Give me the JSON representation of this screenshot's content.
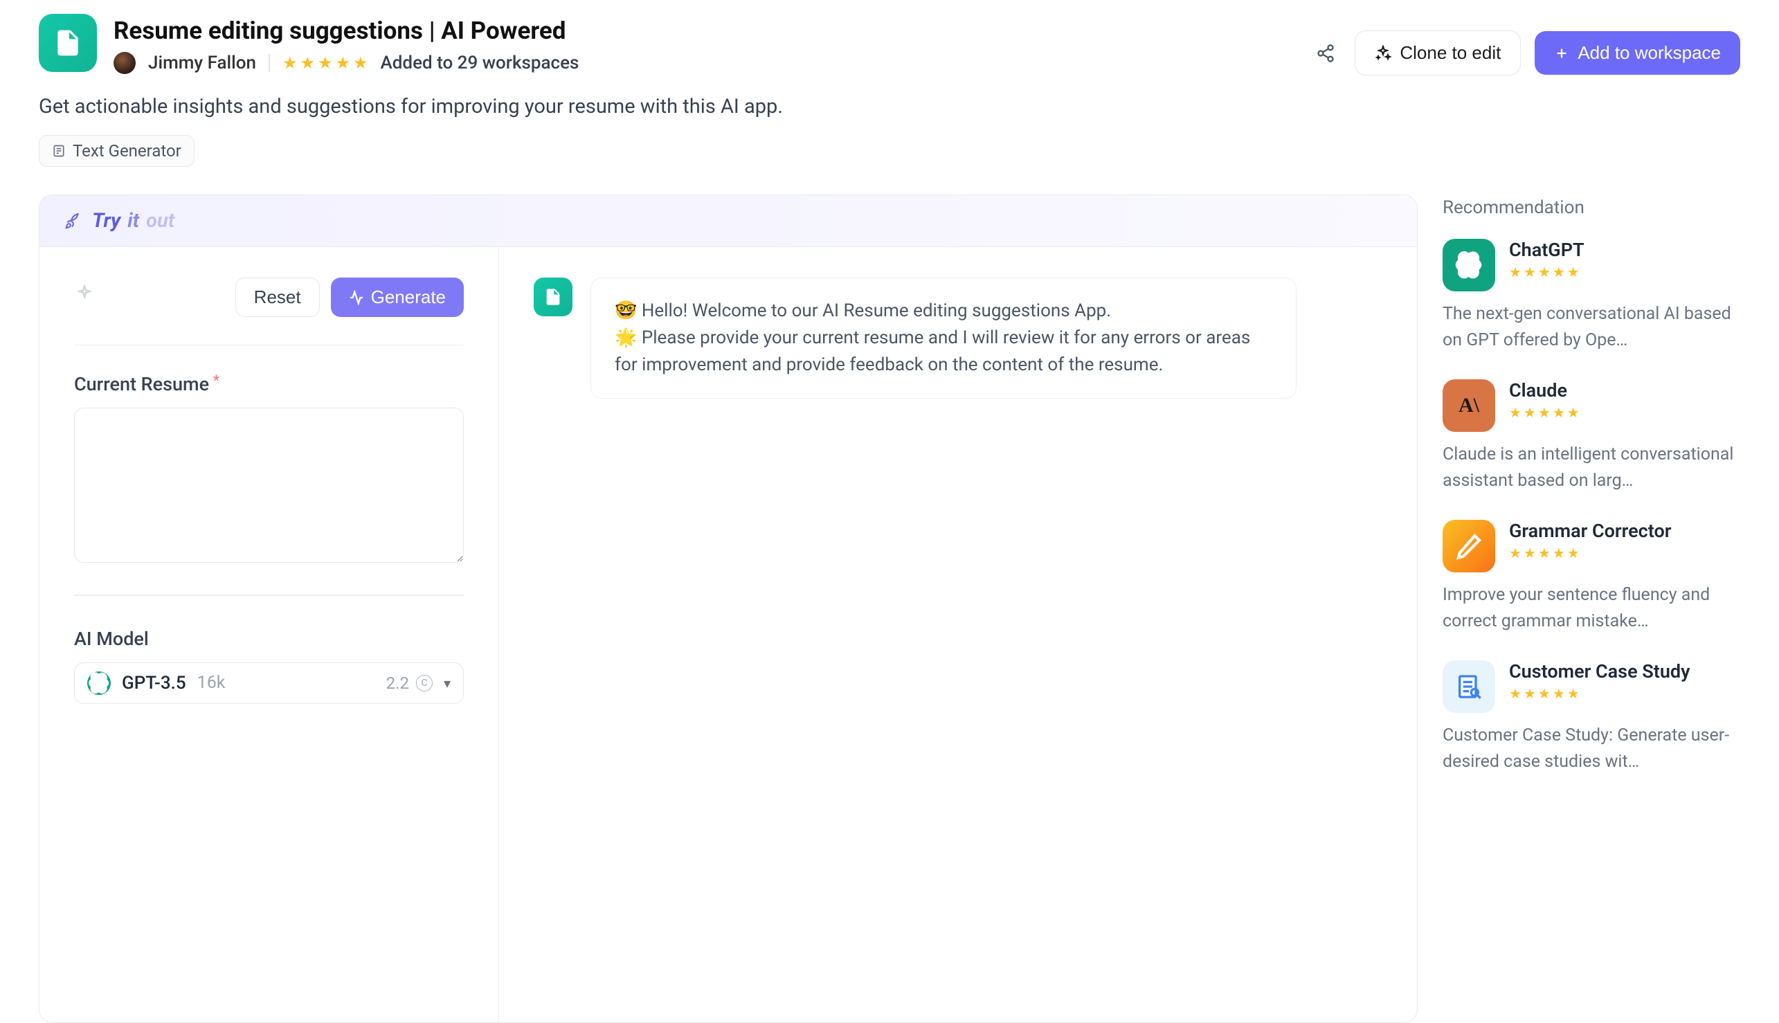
{
  "header": {
    "title": "Resume editing suggestions | AI Powered",
    "author": "Jimmy Fallon",
    "stars": 5,
    "added_to_label": "Added to 29 workspaces",
    "clone_label": "Clone to edit",
    "add_label": "Add to workspace"
  },
  "description": "Get actionable insights and suggestions for improving your resume with this AI app.",
  "tag": {
    "label": "Text Generator"
  },
  "tryout": {
    "label_try": "Try",
    "label_it": "it",
    "label_out": "out",
    "reset_label": "Reset",
    "generate_label": "Generate",
    "form": {
      "resume_label": "Current Resume",
      "resume_value": "",
      "ai_model_label": "AI Model"
    },
    "model": {
      "name": "GPT-3.5",
      "version": "16k",
      "cost": "2.2"
    },
    "chat": {
      "line1": "🤓 Hello! Welcome to our AI Resume editing suggestions App.",
      "line2": "🌟 Please provide your current resume and I will review it for any errors or areas for improvement and provide feedback on the content of the resume."
    }
  },
  "sidebar": {
    "title": "Recommendation",
    "items": [
      {
        "name": "ChatGPT",
        "stars": 5,
        "desc": "The next-gen conversational AI based on GPT offered by Ope…"
      },
      {
        "name": "Claude",
        "stars": 5,
        "desc": "Claude is an intelligent conversational assistant based on larg…"
      },
      {
        "name": "Grammar Corrector",
        "stars": 5,
        "desc": "Improve your sentence fluency and correct grammar mistake…"
      },
      {
        "name": "Customer Case Study",
        "stars": 5,
        "desc": "Customer Case Study: Generate user-desired case studies wit…"
      }
    ]
  }
}
